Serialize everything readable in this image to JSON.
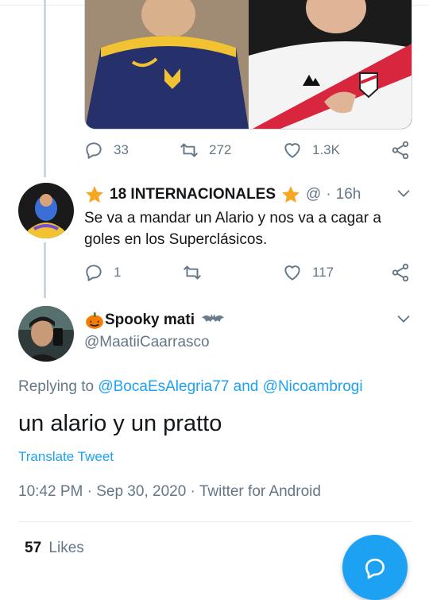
{
  "tweet1": {
    "actions": {
      "replies": "33",
      "retweets": "272",
      "likes": "1.3K"
    }
  },
  "tweet2": {
    "display_name": "18 INTERNACIONALES",
    "handle": "@",
    "separator": "·",
    "time": "16h",
    "text": "Se va a mandar un Alario y nos va a cagar a goles en los Superclásicos.",
    "actions": {
      "replies": "1",
      "retweets": "",
      "likes": "117"
    }
  },
  "main_tweet": {
    "display_name": "Spooky mati",
    "handle": "@MaatiiCaarrasco",
    "replying_prefix": "Replying to",
    "replying_user1": "@BocaEsAlegria77",
    "replying_and": "and",
    "replying_user2": "@Nicoambrogi",
    "text": "un alario y un pratto",
    "translate": "Translate Tweet",
    "time": "10:42 PM",
    "dot": "·",
    "date": "Sep 30, 2020",
    "source": "Twitter for Android",
    "likes_count": "57",
    "likes_label": "Likes"
  },
  "colors": {
    "accent": "#1da1f2",
    "muted": "#657786",
    "text": "#14171a",
    "star": "#f5a623"
  },
  "icons": [
    "reply-icon",
    "retweet-icon",
    "like-icon",
    "share-icon",
    "chevron-down-icon",
    "star-icon",
    "pumpkin-icon",
    "bat-icon",
    "compose-icon"
  ]
}
